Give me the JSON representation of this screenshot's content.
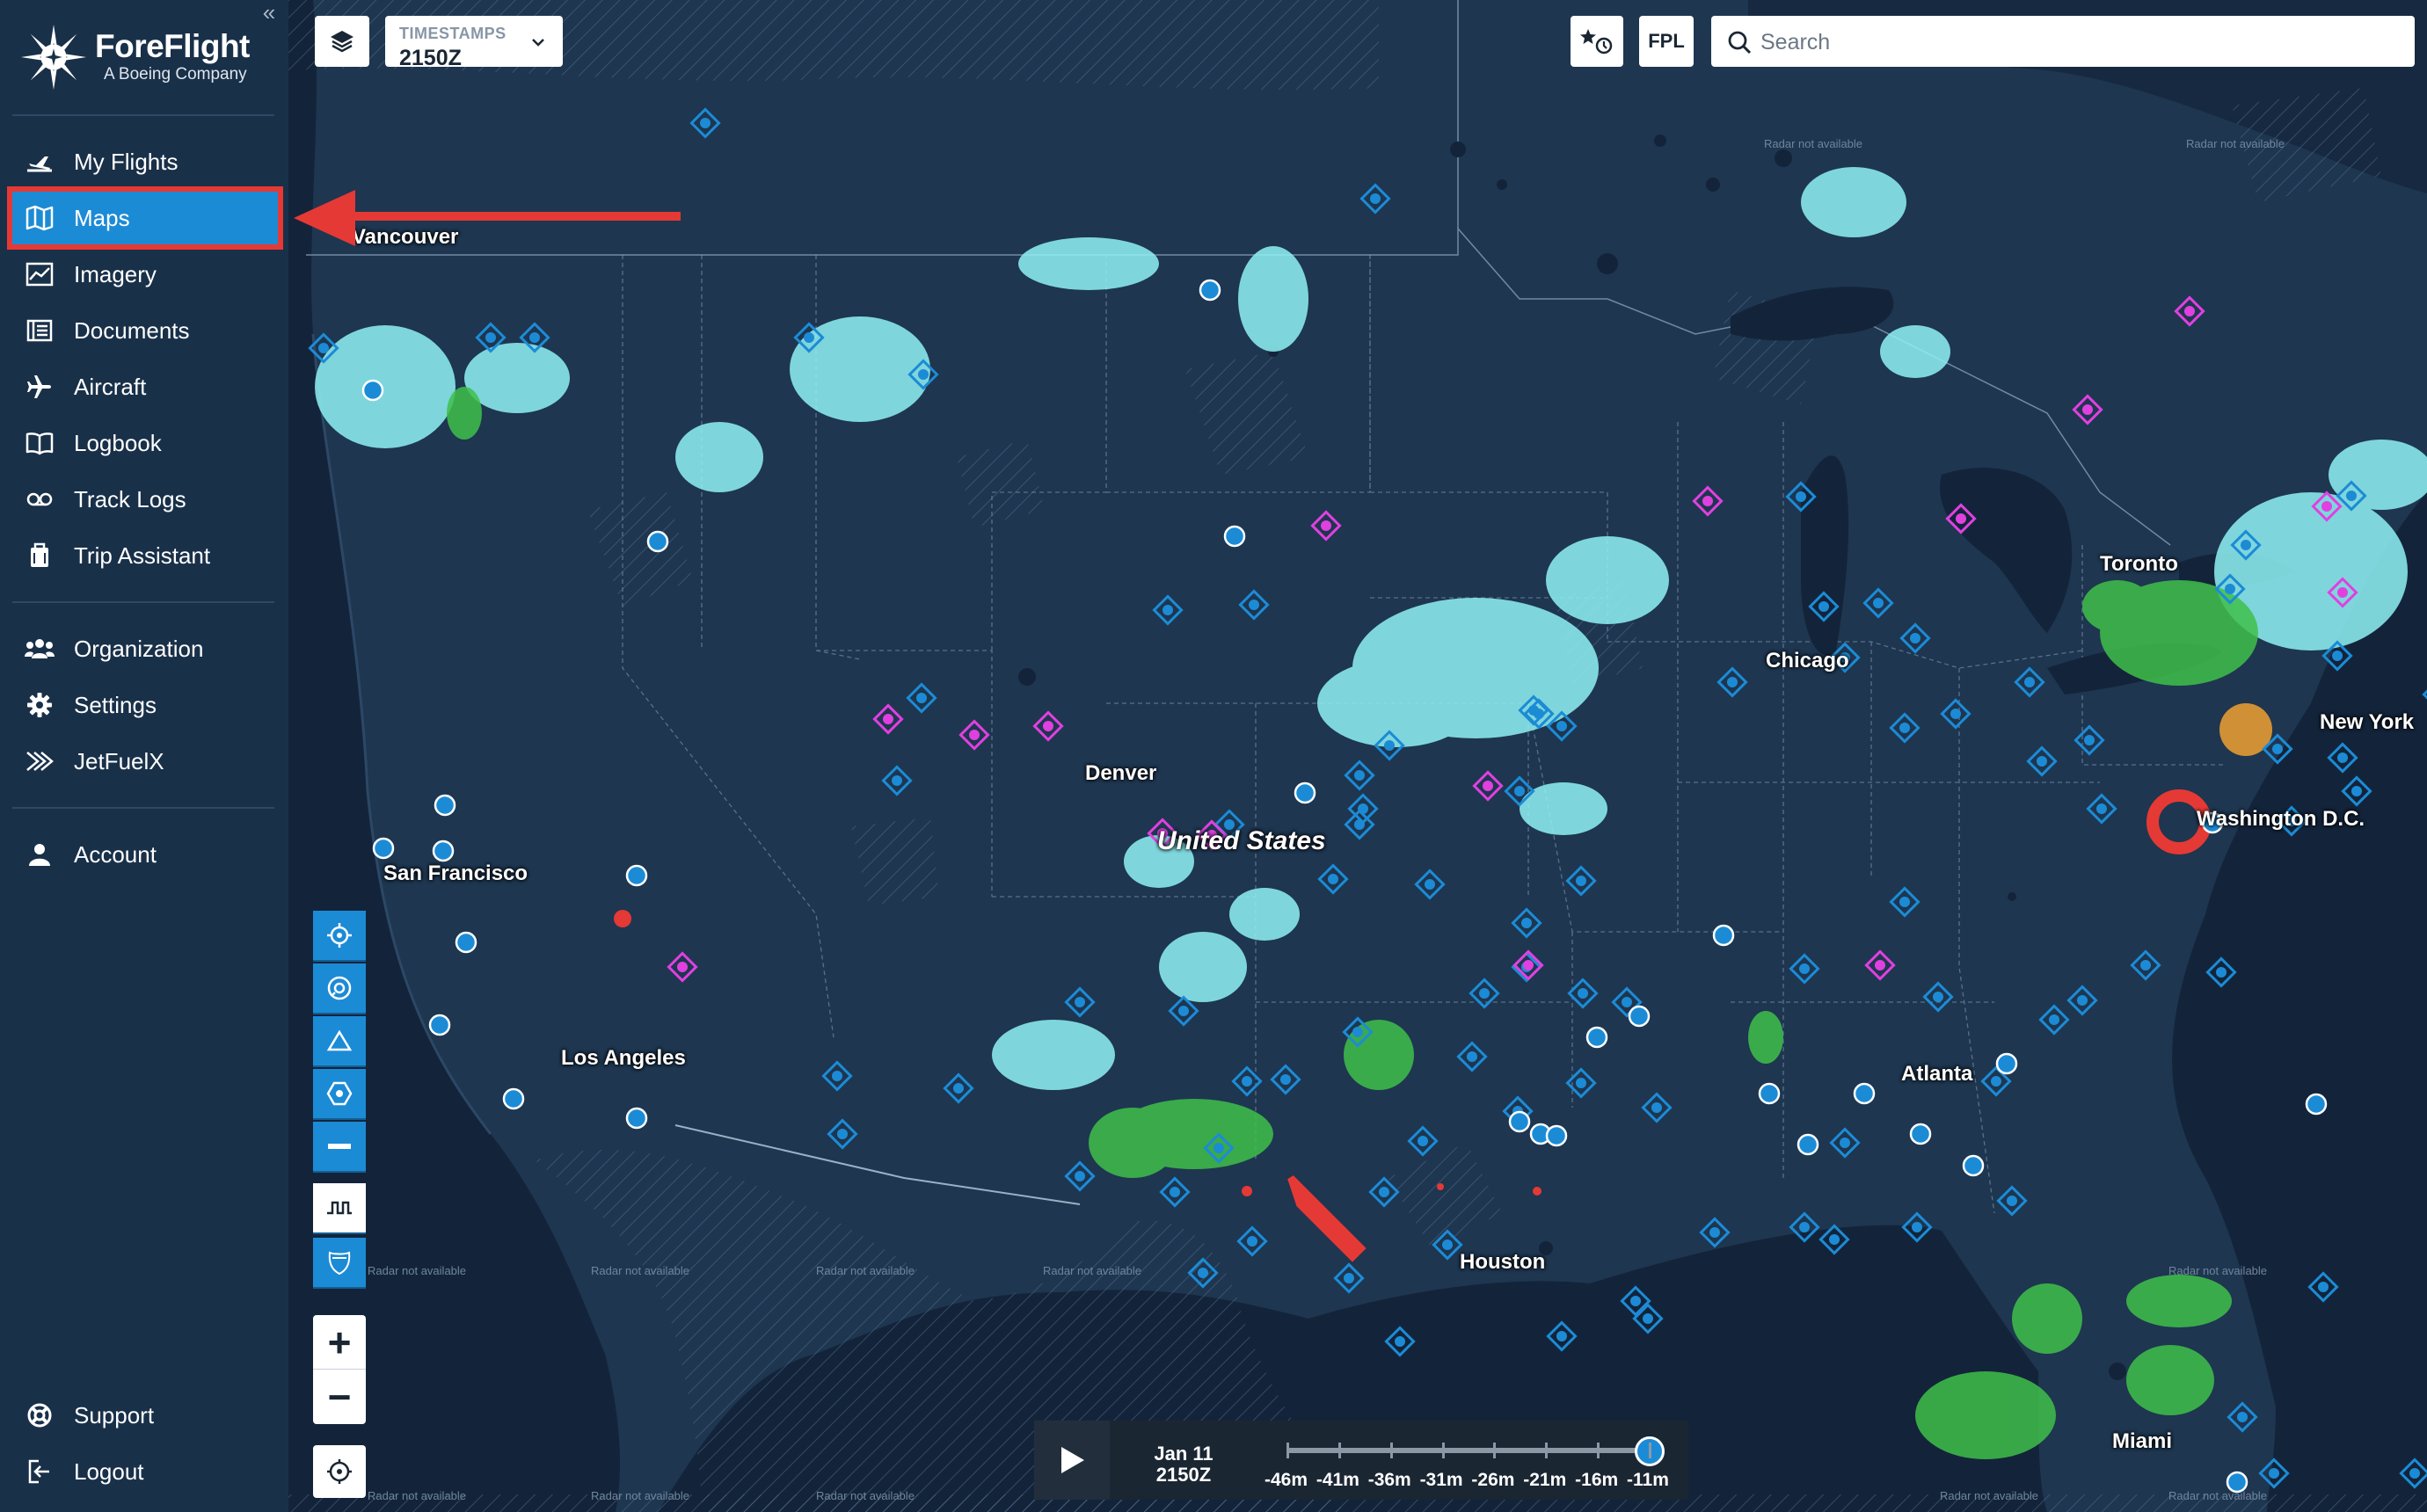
{
  "brand": {
    "name": "ForeFlight",
    "sub": "A Boeing Company",
    "collapse": "«"
  },
  "nav": {
    "main": [
      {
        "label": "My Flights",
        "icon": "flight-takeoff-icon"
      },
      {
        "label": "Maps",
        "icon": "map-icon",
        "active": true
      },
      {
        "label": "Imagery",
        "icon": "chart-line-icon"
      },
      {
        "label": "Documents",
        "icon": "documents-icon"
      },
      {
        "label": "Aircraft",
        "icon": "airplane-icon"
      },
      {
        "label": "Logbook",
        "icon": "book-icon"
      },
      {
        "label": "Track Logs",
        "icon": "track-icon"
      },
      {
        "label": "Trip Assistant",
        "icon": "briefcase-icon"
      }
    ],
    "org": [
      {
        "label": "Organization",
        "icon": "people-icon"
      },
      {
        "label": "Settings",
        "icon": "gear-icon"
      },
      {
        "label": "JetFuelX",
        "icon": "jetfuelx-icon"
      }
    ],
    "account": {
      "label": "Account",
      "icon": "person-icon"
    },
    "bottom": [
      {
        "label": "Support",
        "icon": "lifebuoy-icon"
      },
      {
        "label": "Logout",
        "icon": "logout-icon"
      }
    ]
  },
  "toolbar": {
    "timestamps_label": "TIMESTAMPS",
    "timestamps_value": "2150Z",
    "fpl_label": "FPL",
    "search_placeholder": "Search"
  },
  "map": {
    "country": "United States",
    "cities": [
      "Vancouver",
      "San Francisco",
      "Los Angeles",
      "Denver",
      "Chicago",
      "Toronto",
      "New York",
      "Washington D.C.",
      "Atlanta",
      "Houston",
      "Miami"
    ],
    "radar_na": "Radar not available",
    "colors": {
      "water": "#13243a",
      "land": "#1e3650",
      "airport": "#1c8bd6",
      "restricted": "#e040e0",
      "radar_light": "#8ff2f5",
      "radar_green": "#3fbf4a",
      "radar_red": "#e53935",
      "annotation": "#e53935"
    }
  },
  "timeline": {
    "date": "Jan 11",
    "time": "2150Z",
    "labels": [
      "-46m",
      "-41m",
      "-36m",
      "-31m",
      "-26m",
      "-21m",
      "-16m",
      "-11m"
    ],
    "position": 1.0
  }
}
